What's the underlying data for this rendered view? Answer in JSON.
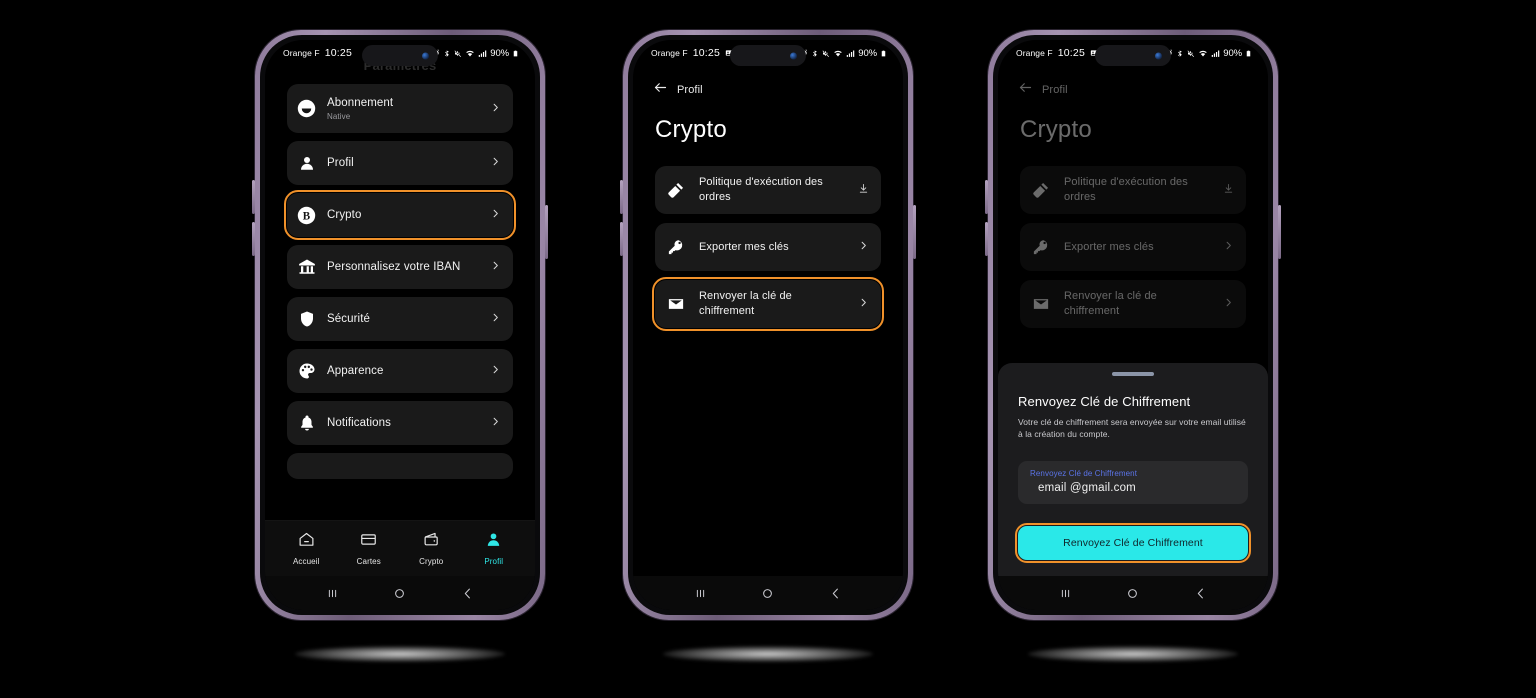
{
  "status_bar": {
    "carrier": "Orange F",
    "time": "10:25",
    "battery": "90%",
    "icons": [
      "screenshot-icon",
      "alarm-icon",
      "bluetooth-icon",
      "mute-icon",
      "wifi-icon",
      "signal-icon",
      "battery-icon"
    ]
  },
  "phone1": {
    "ghost_title": "Paramètres",
    "settings_items": [
      {
        "icon": "subscription-icon",
        "label": "Abonnement",
        "sub": "Native",
        "accessory": "chevron-right-icon",
        "highlighted": false
      },
      {
        "icon": "person-icon",
        "label": "Profil",
        "sub": "",
        "accessory": "chevron-right-icon",
        "highlighted": false
      },
      {
        "icon": "bitcoin-icon",
        "label": "Crypto",
        "sub": "",
        "accessory": "chevron-right-icon",
        "highlighted": true
      },
      {
        "icon": "bank-icon",
        "label": "Personnalisez votre IBAN",
        "sub": "",
        "accessory": "chevron-right-icon",
        "highlighted": false
      },
      {
        "icon": "shield-icon",
        "label": "Sécurité",
        "sub": "",
        "accessory": "chevron-right-icon",
        "highlighted": false
      },
      {
        "icon": "palette-icon",
        "label": "Apparence",
        "sub": "",
        "accessory": "chevron-right-icon",
        "highlighted": false
      },
      {
        "icon": "bell-icon",
        "label": "Notifications",
        "sub": "",
        "accessory": "chevron-right-icon",
        "highlighted": false
      }
    ],
    "tabs": [
      {
        "icon": "home-icon",
        "label": "Accueil",
        "active": false
      },
      {
        "icon": "card-icon",
        "label": "Cartes",
        "active": false
      },
      {
        "icon": "wallet-icon",
        "label": "Crypto",
        "active": false
      },
      {
        "icon": "person-icon",
        "label": "Profil",
        "active": true
      }
    ]
  },
  "phone2": {
    "back_label": "Profil",
    "page_title": "Crypto",
    "items": [
      {
        "icon": "gavel-icon",
        "label": "Politique d'exécution des ordres",
        "accessory": "download-icon",
        "highlighted": false
      },
      {
        "icon": "key-icon",
        "label": "Exporter mes clés",
        "accessory": "chevron-right-icon",
        "highlighted": false
      },
      {
        "icon": "envelope-icon",
        "label": "Renvoyer la clé de chiffrement",
        "accessory": "chevron-right-icon",
        "highlighted": true
      }
    ]
  },
  "phone3": {
    "back_label": "Profil",
    "page_title": "Crypto",
    "items": [
      {
        "icon": "gavel-icon",
        "label": "Politique d'exécution des ordres",
        "accessory": "download-icon"
      },
      {
        "icon": "key-icon",
        "label": "Exporter mes clés",
        "accessory": "chevron-right-icon"
      },
      {
        "icon": "envelope-icon",
        "label": "Renvoyer la clé de chiffrement",
        "accessory": "chevron-right-icon"
      }
    ],
    "sheet": {
      "title": "Renvoyez Clé de Chiffrement",
      "description": "Votre clé de chiffrement sera envoyée sur votre email utilisé à la création du compte.",
      "field_label": "Renvoyez Clé de Chiffrement",
      "field_value": "email @gmail.com",
      "cta_label": "Renvoyez Clé de Chiffrement"
    }
  },
  "android_nav": {
    "recents": "recents-icon",
    "home": "home-circle-icon",
    "back": "back-chevron-icon"
  },
  "colors": {
    "highlight": "#f0912a",
    "accent": "#2ae8e8",
    "field_label": "#5b74e8",
    "card_bg": "#1a1a1a",
    "sheet_bg": "#1c1c1e"
  }
}
